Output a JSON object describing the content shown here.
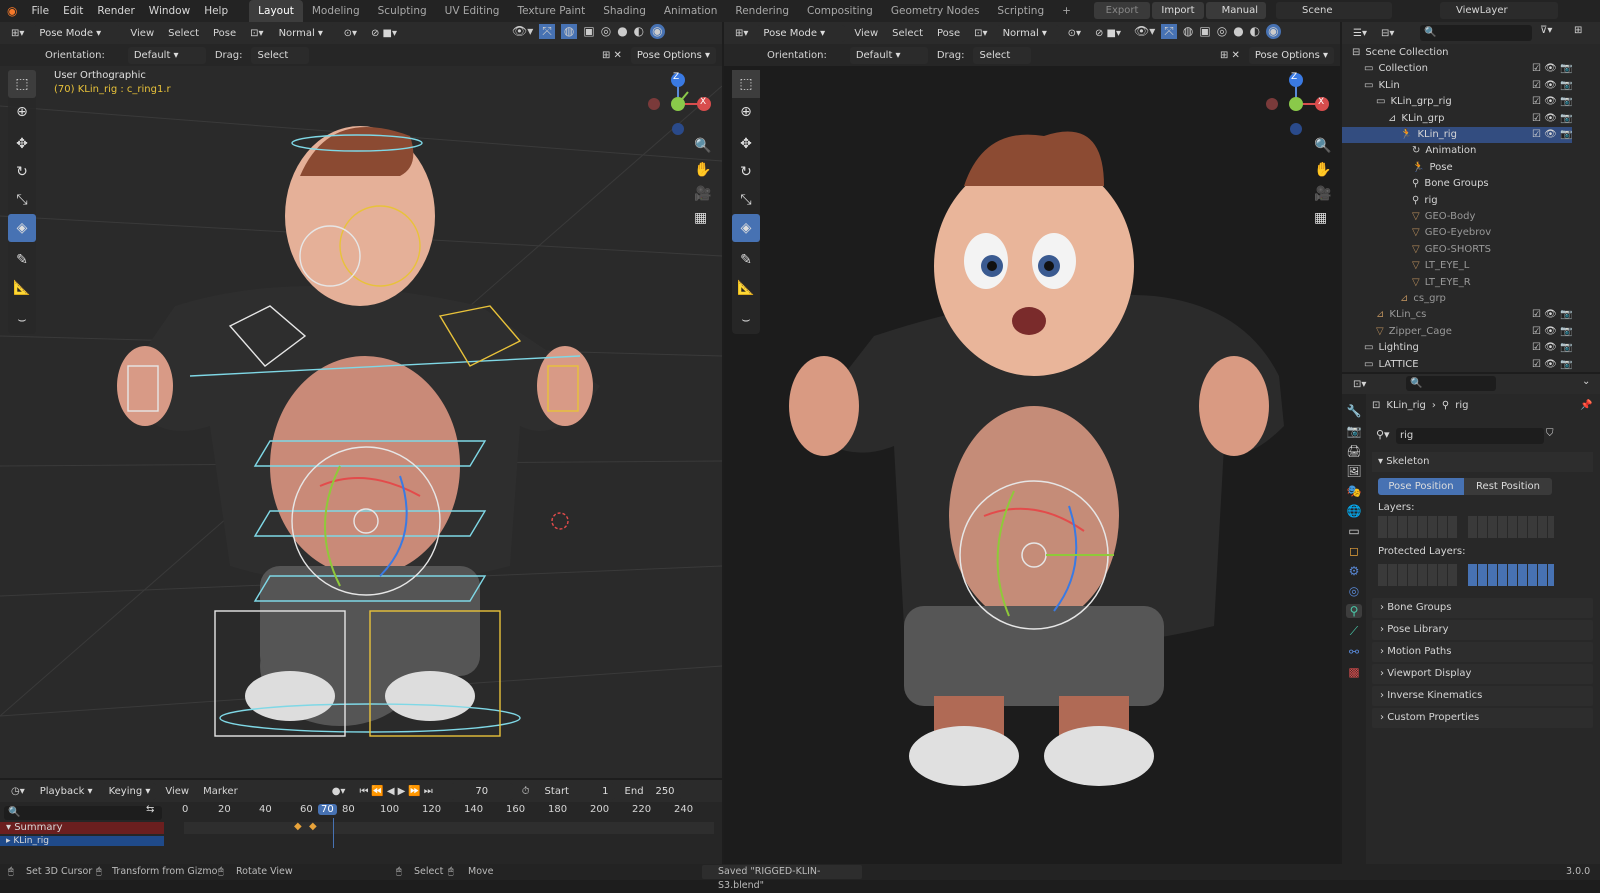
{
  "menu": {
    "file": "File",
    "edit": "Edit",
    "render": "Render",
    "window": "Window",
    "help": "Help"
  },
  "workspaces": [
    "Layout",
    "Modeling",
    "Sculpting",
    "UV Editing",
    "Texture Paint",
    "Shading",
    "Animation",
    "Rendering",
    "Compositing",
    "Geometry Nodes",
    "Scripting"
  ],
  "top_right": {
    "export": "Export",
    "import": "Import",
    "manual": "Manual",
    "scene": "Scene",
    "view_layer": "ViewLayer"
  },
  "viewport_left": {
    "mode": "Pose Mode",
    "view": "View",
    "select": "Select",
    "pose": "Pose",
    "transform": "Normal",
    "orientation_label": "Orientation:",
    "orientation_value": "Default",
    "drag_label": "Drag:",
    "drag_value": "Select Box",
    "pose_options": "Pose Options",
    "view_name": "User Orthographic",
    "active_info": "(70) KLin_rig : c_ring1.r"
  },
  "viewport_right": {
    "mode": "Pose Mode",
    "view": "View",
    "select": "Select",
    "pose": "Pose",
    "transform": "Normal",
    "orientation_label": "Orientation:",
    "orientation_value": "Default",
    "drag_label": "Drag:",
    "drag_value": "Select Box",
    "pose_options": "Pose Options"
  },
  "gizmo": {
    "z": "Z",
    "x": "X"
  },
  "outliner": {
    "items": [
      {
        "label": "Scene Collection",
        "depth": 0
      },
      {
        "label": "Collection",
        "depth": 1
      },
      {
        "label": "KLin",
        "depth": 1
      },
      {
        "label": "KLin_grp_rig",
        "depth": 2
      },
      {
        "label": "KLin_grp",
        "depth": 3
      },
      {
        "label": "KLin_rig",
        "depth": 4
      },
      {
        "label": "Animation",
        "depth": 5
      },
      {
        "label": "Pose",
        "depth": 5
      },
      {
        "label": "Bone Groups",
        "depth": 5
      },
      {
        "label": "rig",
        "depth": 5
      },
      {
        "label": "GEO-Body",
        "depth": 5
      },
      {
        "label": "GEO-Eyebrov",
        "depth": 5
      },
      {
        "label": "GEO-SHORTS",
        "depth": 5
      },
      {
        "label": "LT_EYE_L",
        "depth": 5
      },
      {
        "label": "LT_EYE_R",
        "depth": 5
      },
      {
        "label": "cs_grp",
        "depth": 4
      },
      {
        "label": "KLin_cs",
        "depth": 2
      },
      {
        "label": "Zipper_Cage",
        "depth": 2
      },
      {
        "label": "Lighting",
        "depth": 1
      },
      {
        "label": "LATTICE",
        "depth": 1
      }
    ]
  },
  "properties": {
    "breadcrumb_object": "KLin_rig",
    "breadcrumb_data": "rig",
    "data_name": "rig",
    "skeleton": "Skeleton",
    "pose_position": "Pose Position",
    "rest_position": "Rest Position",
    "layers": "Layers:",
    "protected_layers": "Protected Layers:",
    "panels": [
      "Bone Groups",
      "Pose Library",
      "Motion Paths",
      "Viewport Display",
      "Inverse Kinematics",
      "Custom Properties"
    ]
  },
  "timeline": {
    "playback": "Playback",
    "keying": "Keying",
    "view": "View",
    "marker": "Marker",
    "current_frame": "70",
    "start_label": "Start",
    "start": "1",
    "end_label": "End",
    "end": "250",
    "ticks": [
      "0",
      "20",
      "40",
      "60",
      "70",
      "80",
      "100",
      "120",
      "140",
      "160",
      "180",
      "200",
      "220",
      "240"
    ],
    "summary": "Summary",
    "channel": "KLin_rig"
  },
  "status": {
    "left1": "Set 3D Cursor",
    "left2": "Transform from Gizmo",
    "left3": "Rotate View",
    "mid1": "Select",
    "mid2": "Move",
    "saved": "Saved \"RIGGED-KLIN-S3.blend\"",
    "version": "3.0.0"
  },
  "colors": {
    "accent": "#4772b3",
    "selected_row": "#334d80",
    "summary_row": "#6b1f1f",
    "rig_yellow": "#e8c23a",
    "rig_cyan": "#7fd8e6"
  }
}
